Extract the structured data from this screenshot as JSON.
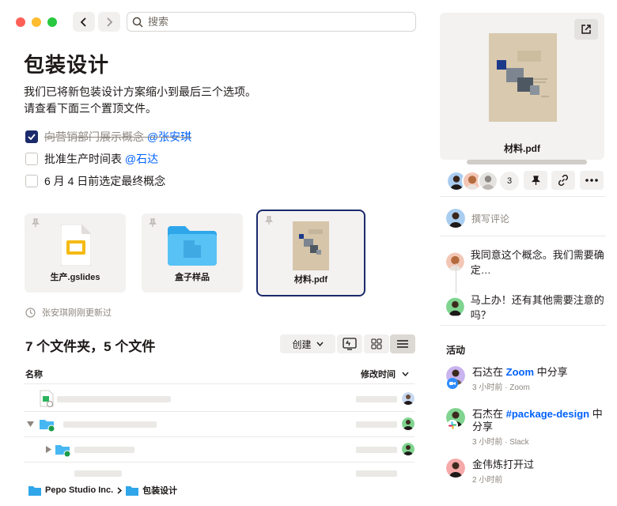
{
  "search": {
    "placeholder": "搜索"
  },
  "page": {
    "title": "包装设计",
    "description_line1": "我们已将新包装设计方案缩小到最后三个选项。",
    "description_line2": "请查看下面三个置顶文件。"
  },
  "tasks": [
    {
      "text": "向营销部门展示概念",
      "mention": "@张安琪",
      "checked": true
    },
    {
      "text": "批准生产时间表",
      "mention": "@石达",
      "checked": false
    },
    {
      "text": "6 月 4 日前选定最终概念",
      "mention": "",
      "checked": false
    }
  ],
  "pinned": [
    {
      "label": "生产.gslides",
      "icon": "slides-icon"
    },
    {
      "label": "盒子样品",
      "icon": "folder-icon"
    },
    {
      "label": "材料.pdf",
      "icon": "pdf-thumbnail"
    }
  ],
  "updated_note": "张安琪刚刚更新过",
  "files": {
    "count_label": "7 个文件夹，5 个文件",
    "create_label": "创建",
    "col_name": "名称",
    "col_modified": "修改时间"
  },
  "breadcrumb": {
    "root": "Pepo Studio Inc.",
    "current": "包装设计"
  },
  "preview": {
    "filename": "材料.pdf"
  },
  "sharing": {
    "extra_count": "3"
  },
  "comments": {
    "placeholder": "撰写评论",
    "items": [
      {
        "text": "我同意这个概念。我们需要确定…"
      },
      {
        "text": "马上办！还有其他需要注意的吗？"
      }
    ]
  },
  "activity": {
    "heading": "活动",
    "items": [
      {
        "pre": "石达在 ",
        "link": "Zoom",
        "post": " 中分享",
        "meta": "3 小时前 · Zoom"
      },
      {
        "pre": "石杰在 ",
        "link": "#package-design",
        "post": " 中分享",
        "meta": "3 小时前 · Slack"
      },
      {
        "pre": "金伟炼打开过",
        "link": "",
        "post": "",
        "meta": "2 小时前"
      }
    ]
  },
  "colors": {
    "accent_navy": "#1b2a6b",
    "link_blue": "#0061fe",
    "folder_blue": "#46b7f2",
    "mac_red": "#ff5f57",
    "mac_yellow": "#febc2e",
    "mac_green": "#28c840"
  }
}
